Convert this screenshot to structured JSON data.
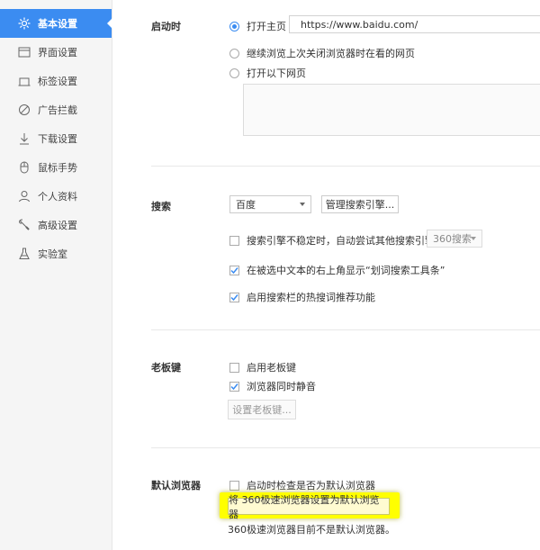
{
  "sidebar": {
    "items": [
      {
        "label": "基本设置",
        "icon": "gear-icon",
        "active": true
      },
      {
        "label": "界面设置",
        "icon": "window-icon"
      },
      {
        "label": "标签设置",
        "icon": "tab-icon"
      },
      {
        "label": "广告拦截",
        "icon": "block-icon"
      },
      {
        "label": "下载设置",
        "icon": "download-icon"
      },
      {
        "label": "鼠标手势",
        "icon": "mouse-icon"
      },
      {
        "label": "个人资料",
        "icon": "user-icon"
      },
      {
        "label": "高级设置",
        "icon": "wrench-icon"
      },
      {
        "label": "实验室",
        "icon": "flask-icon"
      }
    ],
    "accent_color": "#3b8cf1"
  },
  "startup": {
    "label": "启动时",
    "option_home": "打开主页",
    "home_url": "https://www.baidu.com/",
    "option_restore": "继续浏览上次关闭浏览器时在看的网页",
    "option_pages": "打开以下网页",
    "selected": "option_home"
  },
  "search": {
    "label": "搜索",
    "engine": "百度",
    "manage_button": "管理搜索引擎...",
    "fallback_text": "搜索引擎不稳定时，自动尝试其他搜索引擎：",
    "fallback_checked": false,
    "fallback_engine": "360搜索",
    "toolbar_text": "在被选中文本的右上角显示“划词搜索工具条”",
    "toolbar_checked": true,
    "hotwords_text": "启用搜索栏的热搜词推荐功能",
    "hotwords_checked": true
  },
  "bosskey": {
    "label": "老板键",
    "enable_text": "启用老板键",
    "enable_checked": false,
    "mute_text": "浏览器同时静音",
    "mute_checked": true,
    "set_button": "设置老板键..."
  },
  "default_browser": {
    "label": "默认浏览器",
    "check_text": "启动时检查是否为默认浏览器",
    "check_checked": false,
    "set_default_button": "将 360极速浏览器设置为默认浏览器",
    "status_text": "360极速浏览器目前不是默认浏览器。",
    "highlight_color": "#ffff00"
  }
}
